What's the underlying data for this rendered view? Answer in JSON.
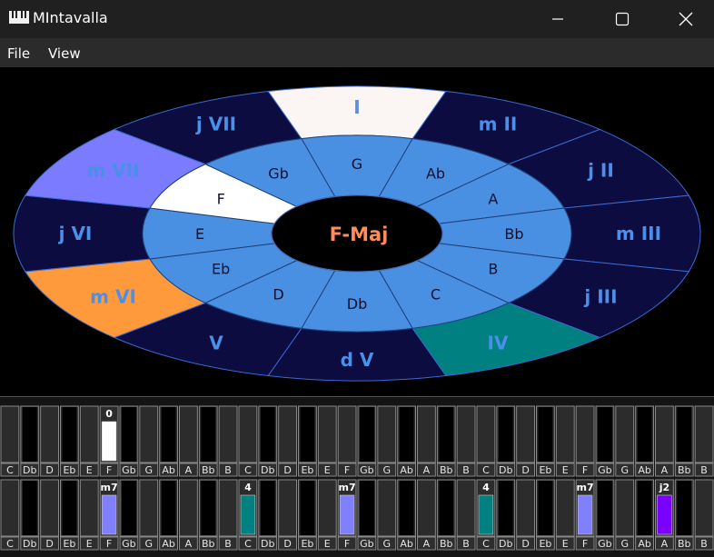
{
  "window": {
    "title": "MIntavalla",
    "icon": "piano-keys-icon",
    "controls": [
      "minimize-icon",
      "maximize-icon",
      "close-icon"
    ]
  },
  "menu": {
    "file_label": "File",
    "view_label": "View"
  },
  "wheel": {
    "center_label": "F-Maj",
    "center_color": "#ff8c5a",
    "outer_segments": [
      {
        "label": "I",
        "color": "#fbf6f4",
        "text_color": "#5a8fe0"
      },
      {
        "label": "m II",
        "color": "#0c0c40",
        "text_color": "#4a8fe8"
      },
      {
        "label": "j II",
        "color": "#0c0c40",
        "text_color": "#4a8fe8"
      },
      {
        "label": "m III",
        "color": "#0c0c40",
        "text_color": "#4a8fe8"
      },
      {
        "label": "j III",
        "color": "#0c0c40",
        "text_color": "#4a8fe8"
      },
      {
        "label": "IV",
        "color": "#008080",
        "text_color": "#4a8fe8"
      },
      {
        "label": "d V",
        "color": "#0c0c40",
        "text_color": "#4a8fe8"
      },
      {
        "label": "V",
        "color": "#0c0c40",
        "text_color": "#4a8fe8"
      },
      {
        "label": "m VI",
        "color": "#ff9a3c",
        "text_color": "#4a8fe8"
      },
      {
        "label": "j VI",
        "color": "#0c0c40",
        "text_color": "#4a8fe8"
      },
      {
        "label": "m VII",
        "color": "#7b7bff",
        "text_color": "#4a8fe8"
      },
      {
        "label": "j VII",
        "color": "#0c0c40",
        "text_color": "#4a8fe8"
      }
    ],
    "inner_segments": [
      {
        "label": "G",
        "color": "#4a90e2"
      },
      {
        "label": "Ab",
        "color": "#4a90e2"
      },
      {
        "label": "A",
        "color": "#4a90e2"
      },
      {
        "label": "Bb",
        "color": "#4a90e2"
      },
      {
        "label": "B",
        "color": "#4a90e2"
      },
      {
        "label": "C",
        "color": "#4a90e2"
      },
      {
        "label": "Db",
        "color": "#4a90e2"
      },
      {
        "label": "D",
        "color": "#4a90e2"
      },
      {
        "label": "Eb",
        "color": "#4a90e2"
      },
      {
        "label": "E",
        "color": "#4a90e2"
      },
      {
        "label": "F",
        "color": "#ffffff"
      },
      {
        "label": "Gb",
        "color": "#4a90e2"
      }
    ]
  },
  "piano": {
    "note_names": [
      "C",
      "Db",
      "D",
      "Eb",
      "E",
      "F",
      "Gb",
      "G",
      "Ab",
      "A",
      "Bb",
      "B",
      "C",
      "Db",
      "D",
      "Eb",
      "E",
      "F",
      "Gb",
      "G",
      "Ab",
      "A",
      "Bb",
      "B",
      "C",
      "Db",
      "D",
      "Eb",
      "E",
      "F",
      "Gb",
      "G",
      "Ab",
      "A",
      "Bb",
      "B"
    ],
    "row1_highlights": [
      {
        "index": 5,
        "label": "0",
        "color": "#ffffff"
      }
    ],
    "row2_highlights": [
      {
        "index": 5,
        "label": "m7",
        "color": "#8080ff"
      },
      {
        "index": 12,
        "label": "4",
        "color": "#008080"
      },
      {
        "index": 17,
        "label": "m7",
        "color": "#8080ff"
      },
      {
        "index": 24,
        "label": "4",
        "color": "#008080"
      },
      {
        "index": 29,
        "label": "m7",
        "color": "#8080ff"
      },
      {
        "index": 33,
        "label": "j2",
        "color": "#7a00ff"
      }
    ]
  }
}
